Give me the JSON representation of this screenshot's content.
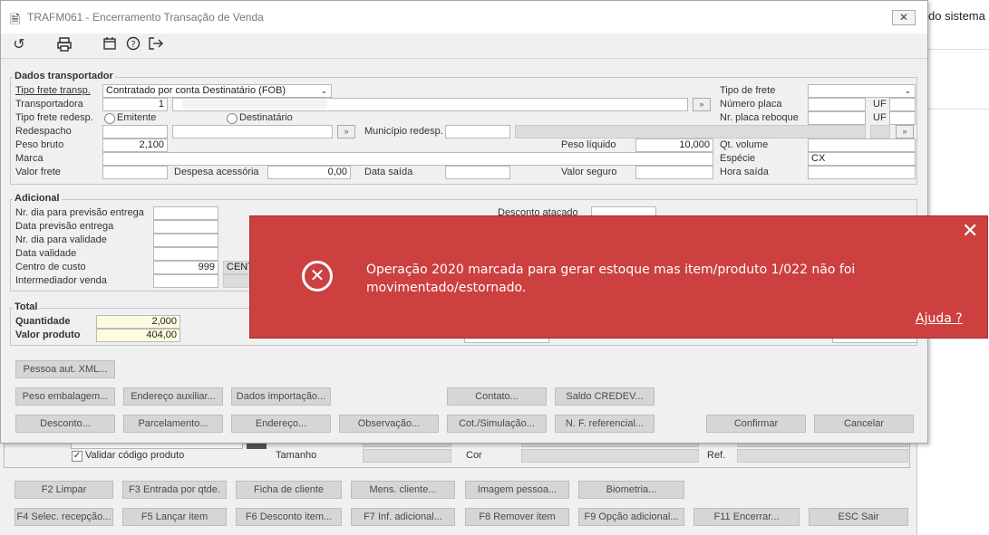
{
  "background": {
    "partial_title": "do sistema",
    "check_label": "Validar código produto",
    "tamanho_label": "Tamanho",
    "cor_label": "Cor",
    "ref_label": "Ref.",
    "fkeys_row1": [
      "F2 Limpar",
      "F3 Entrada por qtde.",
      "Ficha de cliente",
      "Mens. cliente...",
      "Imagem pessoa...",
      "Biometria..."
    ],
    "fkeys_row2": [
      "F4 Selec. recepção...",
      "F5 Lançar item",
      "F6 Desconto item...",
      "F7 Inf. adicional...",
      "F8 Remover item",
      "F9 Opção adicional...",
      "F11 Encerrar...",
      "ESC Sair"
    ]
  },
  "dialog": {
    "title": "TRAFM061 - Encerramento Transação de Venda",
    "close_glyph": "✕",
    "transportador": {
      "title": "Dados transportador",
      "tipo_frete_transp_label": "Tipo frete transp.",
      "tipo_frete_transp_value": "Contratado por conta Destinatário (FOB)",
      "transportadora_label": "Transportadora",
      "transportadora_value": "1",
      "tipo_frete_redesp_label": "Tipo frete redesp.",
      "emitente_label": "Emitente",
      "destinatario_label": "Destinatário",
      "redespacho_label": "Redespacho",
      "municipio_redesp_label": "Município redesp.",
      "peso_bruto_label": "Peso bruto",
      "peso_bruto_value": "2,100",
      "peso_liquido_label": "Peso líquido",
      "peso_liquido_value": "10,000",
      "marca_label": "Marca",
      "valor_frete_label": "Valor frete",
      "despesa_acessoria_label": "Despesa acessória",
      "despesa_acessoria_value": "0,00",
      "data_saida_label": "Data saída",
      "valor_seguro_label": "Valor seguro",
      "tipo_de_frete_label": "Tipo de frete",
      "numero_placa_label": "Número placa",
      "uf_label": "UF",
      "nr_placa_reboque_label": "Nr. placa reboque",
      "qt_volume_label": "Qt. volume",
      "especie_label": "Espécie",
      "especie_value": "CX",
      "hora_saida_label": "Hora saída"
    },
    "adicional": {
      "title": "Adicional",
      "nr_dia_prev_label": "Nr. dia para previsão entrega",
      "data_prev_label": "Data previsão entrega",
      "nr_dia_validade_label": "Nr. dia para validade",
      "data_validade_label": "Data validade",
      "centro_custo_label": "Centro de custo",
      "centro_custo_value": "999",
      "centro_custo_desc": "CENT",
      "intermediador_label": "Intermediador venda",
      "desconto_atacado_label": "Desconto atacado"
    },
    "total": {
      "title": "Total",
      "quantidade_label": "Quantidade",
      "quantidade_value": "2,000",
      "valor_produto_label": "Valor produto",
      "valor_produto_value": "404,00"
    },
    "buttons": {
      "pessoa_xml": "Pessoa aut. XML...",
      "peso_embalagem": "Peso embalagem...",
      "endereco_auxiliar": "Endereço auxiliar...",
      "dados_importacao": "Dados importação...",
      "contato": "Contato...",
      "saldo_credev": "Saldo CREDEV...",
      "desconto": "Desconto...",
      "parcelamento": "Parcelamento...",
      "endereco": "Endereço...",
      "observacao": "Observação...",
      "cot_simulacao": "Cot./Simulação...",
      "nf_referencial": "N. F. referencial...",
      "confirmar": "Confirmar",
      "cancelar": "Cancelar"
    }
  },
  "toast": {
    "message": "Operação 2020 marcada para gerar estoque mas item/produto 1/022 não foi movimentado/estornado.",
    "help_link": "Ajuda ?",
    "close_glyph": "✕",
    "error_glyph": "✕",
    "color": "#cc4040"
  }
}
